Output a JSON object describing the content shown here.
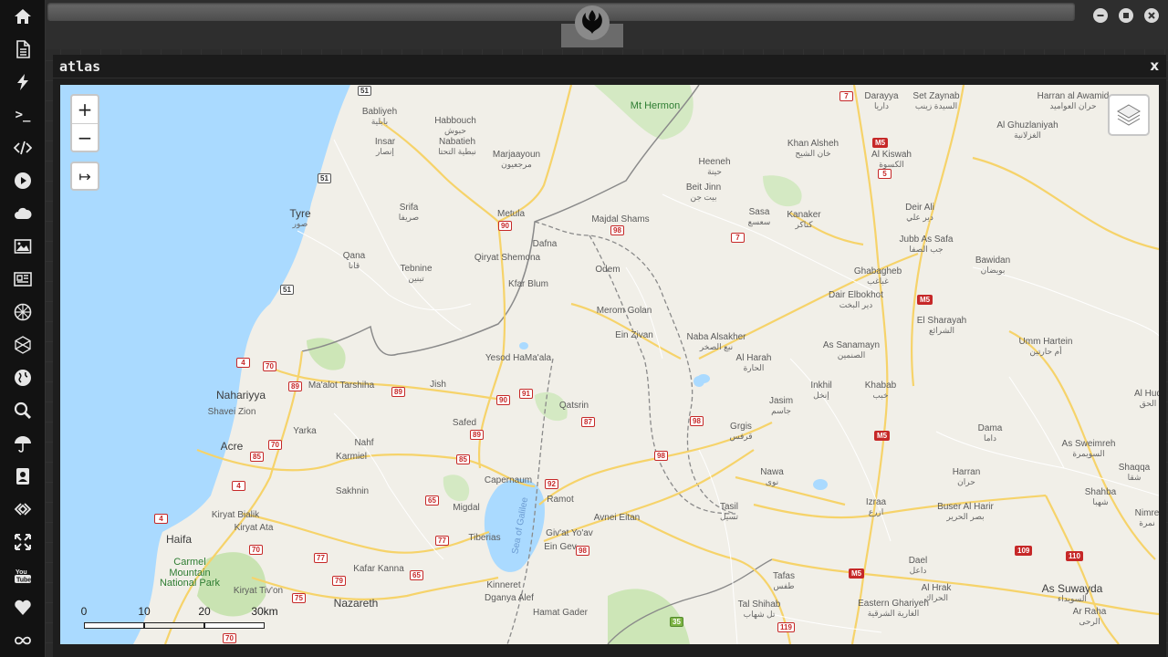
{
  "sidebar": {
    "icons": [
      "home-icon",
      "document-icon",
      "bolt-icon",
      "terminal-icon",
      "code-icon",
      "play-icon",
      "cloud-icon",
      "image-icon",
      "newspaper-icon",
      "rebel-icon",
      "hexagon-icon",
      "globe-icon",
      "search-icon",
      "umbrella-icon",
      "contact-icon",
      "link-icon",
      "expand-icon",
      "youtube-icon",
      "heart-icon",
      "infinity-icon"
    ]
  },
  "window": {
    "minimize": "minimize-icon",
    "maximize": "maximize-icon",
    "close": "close-icon"
  },
  "panel": {
    "title": "atlas",
    "close_label": "x"
  },
  "map": {
    "zoom_in": "+",
    "zoom_out": "−",
    "expand_label": "↦",
    "scale": {
      "labels": [
        "0",
        "10",
        "20",
        "30km"
      ]
    },
    "places": [
      {
        "en": "Mt Hermon",
        "ar": "",
        "kind": "park"
      },
      {
        "en": "Set Zaynab",
        "ar": "السيدة زينب",
        "kind": "town"
      },
      {
        "en": "Darayya",
        "ar": "داريا",
        "kind": "town"
      },
      {
        "en": "Harran al Awamid",
        "ar": "حران العواميد",
        "kind": "town"
      },
      {
        "en": "Al Ghuzlaniyah",
        "ar": "الغزلانية",
        "kind": "town"
      },
      {
        "en": "Babliyeh",
        "ar": "بابلية",
        "kind": "town"
      },
      {
        "en": "Habbouch",
        "ar": "حبوش",
        "kind": "town"
      },
      {
        "en": "Insar",
        "ar": "إنصار",
        "kind": "town"
      },
      {
        "en": "Nabatieh",
        "ar": "نبطية التحتا",
        "kind": "town"
      },
      {
        "en": "Marjaayoun",
        "ar": "مرجعيون",
        "kind": "town"
      },
      {
        "en": "Khan Alsheh",
        "ar": "خان الشيح",
        "kind": "town"
      },
      {
        "en": "Al Kiswah",
        "ar": "الكسوة",
        "kind": "town"
      },
      {
        "en": "Heeneh",
        "ar": "حينة",
        "kind": "town"
      },
      {
        "en": "Beit Jinn",
        "ar": "بيت جن",
        "kind": "town"
      },
      {
        "en": "Sasa",
        "ar": "سعسع",
        "kind": "town"
      },
      {
        "en": "Kanaker",
        "ar": "كناكر",
        "kind": "town"
      },
      {
        "en": "Deir Ali",
        "ar": "دير علي",
        "kind": "town"
      },
      {
        "en": "Jubb As Safa",
        "ar": "جب الصفا",
        "kind": "town"
      },
      {
        "en": "Bawidan",
        "ar": "بويضان",
        "kind": "town"
      },
      {
        "en": "Tyre",
        "ar": "صور",
        "kind": "city"
      },
      {
        "en": "Srifa",
        "ar": "صريفا",
        "kind": "town"
      },
      {
        "en": "Metula",
        "ar": "",
        "kind": "town"
      },
      {
        "en": "Majdal Shams",
        "ar": "",
        "kind": "town"
      },
      {
        "en": "Qana",
        "ar": "قانا",
        "kind": "town"
      },
      {
        "en": "Tebnine",
        "ar": "تبنين",
        "kind": "town"
      },
      {
        "en": "Qiryat Shemona",
        "ar": "",
        "kind": "town"
      },
      {
        "en": "Dafna",
        "ar": "",
        "kind": "town"
      },
      {
        "en": "Odem",
        "ar": "",
        "kind": "town"
      },
      {
        "en": "Ghabagheb",
        "ar": "غباغب",
        "kind": "town"
      },
      {
        "en": "Kfar Blum",
        "ar": "",
        "kind": "town"
      },
      {
        "en": "Dair Elbokhot",
        "ar": "دير البخت",
        "kind": "town"
      },
      {
        "en": "Merom Golan",
        "ar": "",
        "kind": "town"
      },
      {
        "en": "El Sharayah",
        "ar": "الشرائع",
        "kind": "town"
      },
      {
        "en": "Ein Zivan",
        "ar": "",
        "kind": "town"
      },
      {
        "en": "Naba Alsakher",
        "ar": "نبع الصخر",
        "kind": "town"
      },
      {
        "en": "As Sanamayn",
        "ar": "الصنمين",
        "kind": "town"
      },
      {
        "en": "Umm Hartein",
        "ar": "أم حارتين",
        "kind": "town"
      },
      {
        "en": "Yesod HaMa'ala",
        "ar": "",
        "kind": "town"
      },
      {
        "en": "Al Harah",
        "ar": "الحارة",
        "kind": "town"
      },
      {
        "en": "Nahariyya",
        "ar": "",
        "kind": "city"
      },
      {
        "en": "Ma'alot Tarshiha",
        "ar": "",
        "kind": "town"
      },
      {
        "en": "Jish",
        "ar": "",
        "kind": "town"
      },
      {
        "en": "Inkhil",
        "ar": "إنخل",
        "kind": "town"
      },
      {
        "en": "Khabab",
        "ar": "خبب",
        "kind": "town"
      },
      {
        "en": "Shavei Zion",
        "ar": "",
        "kind": "town"
      },
      {
        "en": "Qatsrin",
        "ar": "",
        "kind": "town"
      },
      {
        "en": "Jasim",
        "ar": "جاسم",
        "kind": "town"
      },
      {
        "en": "Al Huq",
        "ar": "الحق",
        "kind": "town"
      },
      {
        "en": "Yarka",
        "ar": "",
        "kind": "town"
      },
      {
        "en": "Safed",
        "ar": "",
        "kind": "town"
      },
      {
        "en": "Grgis",
        "ar": "قرفس",
        "kind": "town"
      },
      {
        "en": "Dama",
        "ar": "داما",
        "kind": "town"
      },
      {
        "en": "Acre",
        "ar": "",
        "kind": "city"
      },
      {
        "en": "Nahf",
        "ar": "",
        "kind": "town"
      },
      {
        "en": "As Sweimreh",
        "ar": "السويمرة",
        "kind": "town"
      },
      {
        "en": "Karmiel",
        "ar": "",
        "kind": "town"
      },
      {
        "en": "Shaqqa",
        "ar": "شقا",
        "kind": "town"
      },
      {
        "en": "Nawa",
        "ar": "نوى",
        "kind": "town"
      },
      {
        "en": "Harran",
        "ar": "حران",
        "kind": "town"
      },
      {
        "en": "Capernaum",
        "ar": "",
        "kind": "town"
      },
      {
        "en": "Sakhnin",
        "ar": "",
        "kind": "town"
      },
      {
        "en": "Ramot",
        "ar": "",
        "kind": "town"
      },
      {
        "en": "Shahba",
        "ar": "شهبا",
        "kind": "town"
      },
      {
        "en": "Izraa",
        "ar": "ازرع",
        "kind": "town"
      },
      {
        "en": "Buser Al Harir",
        "ar": "بصر الحرير",
        "kind": "town"
      },
      {
        "en": "Migdal",
        "ar": "",
        "kind": "town"
      },
      {
        "en": "Kiryat Bialik",
        "ar": "",
        "kind": "town"
      },
      {
        "en": "Avnei Eitan",
        "ar": "",
        "kind": "town"
      },
      {
        "en": "Tasil",
        "ar": "تسيل",
        "kind": "town"
      },
      {
        "en": "Nimre",
        "ar": "نمرة",
        "kind": "town"
      },
      {
        "en": "Kiryat Ata",
        "ar": "",
        "kind": "town"
      },
      {
        "en": "Tiberias",
        "ar": "",
        "kind": "town"
      },
      {
        "en": "Giv'at Yo'av",
        "ar": "",
        "kind": "town"
      },
      {
        "en": "Haifa",
        "ar": "",
        "kind": "city"
      },
      {
        "en": "Ein Gev",
        "ar": "",
        "kind": "town"
      },
      {
        "en": "Carmel Mountain National Park",
        "ar": "",
        "kind": "park"
      },
      {
        "en": "Dael",
        "ar": "داعل",
        "kind": "town"
      },
      {
        "en": "Al Hrak",
        "ar": "الحراك",
        "kind": "town"
      },
      {
        "en": "Kafar Kanna",
        "ar": "",
        "kind": "town"
      },
      {
        "en": "As Suwayda",
        "ar": "السويداء",
        "kind": "city"
      },
      {
        "en": "Kinneret",
        "ar": "",
        "kind": "town"
      },
      {
        "en": "Tafas",
        "ar": "طفس",
        "kind": "town"
      },
      {
        "en": "Kiryat Tiv'on",
        "ar": "",
        "kind": "town"
      },
      {
        "en": "Dganya Alef",
        "ar": "",
        "kind": "town"
      },
      {
        "en": "Nazareth",
        "ar": "",
        "kind": "city"
      },
      {
        "en": "Tal Shihab",
        "ar": "تل شهاب",
        "kind": "town"
      },
      {
        "en": "Eastern Ghariyeh",
        "ar": "الغارية الشرقية",
        "kind": "town"
      },
      {
        "en": "Ar Raha",
        "ar": "الرحى",
        "kind": "town"
      },
      {
        "en": "Hamat Gader",
        "ar": "",
        "kind": "town"
      },
      {
        "en": "Sea of Galilee",
        "ar": "",
        "kind": "water"
      }
    ],
    "shields": [
      "51",
      "51",
      "51",
      "7",
      "M5",
      "5",
      "90",
      "98",
      "7",
      "M5",
      "4",
      "70",
      "89",
      "89",
      "90",
      "91",
      "87",
      "98",
      "70",
      "85",
      "89",
      "85",
      "98",
      "M5",
      "4",
      "65",
      "92",
      "4",
      "77",
      "98",
      "70",
      "77",
      "65",
      "79",
      "75",
      "70",
      "M5",
      "109",
      "110",
      "119",
      "35"
    ]
  }
}
